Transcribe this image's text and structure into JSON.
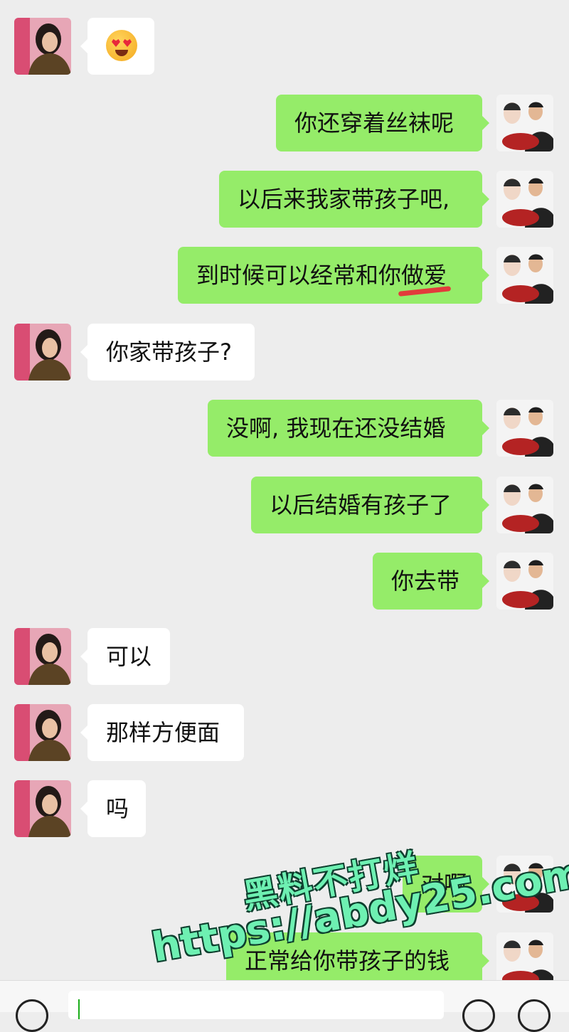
{
  "colors": {
    "background": "#ededed",
    "sent_bubble": "#95ec69",
    "received_bubble": "#ffffff",
    "strike": "#e23b3b",
    "watermark": "#6ef0b2"
  },
  "messages": [
    {
      "side": "left",
      "type": "emoji",
      "emoji_name": "heart-eyes-emoji"
    },
    {
      "side": "right",
      "text": "你还穿着丝袜呢"
    },
    {
      "side": "right",
      "text": "以后来我家带孩子吧,"
    },
    {
      "side": "right",
      "text": "到时候可以经常和你",
      "struck_text": "做爱"
    },
    {
      "side": "left",
      "text": "你家带孩子?"
    },
    {
      "side": "right",
      "text": "没啊, 我现在还没结婚"
    },
    {
      "side": "right",
      "text": "以后结婚有孩子了"
    },
    {
      "side": "right",
      "text": "你去带"
    },
    {
      "side": "left",
      "text": "可以"
    },
    {
      "side": "left",
      "text": "那样方便面"
    },
    {
      "side": "left",
      "text": "吗"
    },
    {
      "side": "right",
      "text": "对啊"
    },
    {
      "side": "right",
      "text": "正常给你带孩子的钱"
    }
  ],
  "watermark": {
    "line1": "黑料不打烊",
    "line2": "https://abdy25.com"
  },
  "input_bar": {
    "voice_icon": "voice-icon",
    "emoji_icon": "smiley-icon",
    "plus_icon": "plus-icon"
  }
}
